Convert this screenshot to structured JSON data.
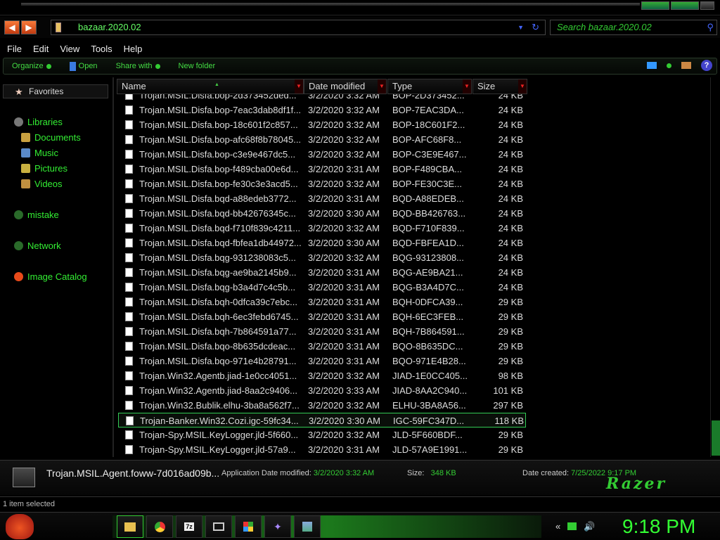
{
  "window": {
    "address": "bazaar.2020.02",
    "search_placeholder": "Search bazaar.2020.02"
  },
  "menu": [
    "File",
    "Edit",
    "View",
    "Tools",
    "Help"
  ],
  "commands": {
    "organize": "Organize",
    "open": "Open",
    "share": "Share with",
    "new_folder": "New folder"
  },
  "nav": {
    "favorites": "Favorites",
    "libraries": "Libraries",
    "documents": "Documents",
    "music": "Music",
    "pictures": "Pictures",
    "videos": "Videos",
    "mistake": "mistake",
    "network": "Network",
    "image_catalog": "Image Catalog"
  },
  "columns": {
    "name": "Name",
    "date": "Date modified",
    "type": "Type",
    "size": "Size"
  },
  "files": [
    [
      "Trojan.MSIL.Disfa.bop-2d373452ded...",
      "3/2/2020 3:32 AM",
      "BOP-2D373452...",
      "24 KB"
    ],
    [
      "Trojan.MSIL.Disfa.bop-7eac3dab8df1f...",
      "3/2/2020 3:32 AM",
      "BOP-7EAC3DA...",
      "24 KB"
    ],
    [
      "Trojan.MSIL.Disfa.bop-18c601f2c857...",
      "3/2/2020 3:32 AM",
      "BOP-18C601F2...",
      "24 KB"
    ],
    [
      "Trojan.MSIL.Disfa.bop-afc68f8b78045...",
      "3/2/2020 3:32 AM",
      "BOP-AFC68F8...",
      "24 KB"
    ],
    [
      "Trojan.MSIL.Disfa.bop-c3e9e467dc5...",
      "3/2/2020 3:32 AM",
      "BOP-C3E9E467...",
      "24 KB"
    ],
    [
      "Trojan.MSIL.Disfa.bop-f489cba00e6d...",
      "3/2/2020 3:31 AM",
      "BOP-F489CBA...",
      "24 KB"
    ],
    [
      "Trojan.MSIL.Disfa.bop-fe30c3e3acd5...",
      "3/2/2020 3:32 AM",
      "BOP-FE30C3E...",
      "24 KB"
    ],
    [
      "Trojan.MSIL.Disfa.bqd-a88edeb3772...",
      "3/2/2020 3:31 AM",
      "BQD-A88EDEB...",
      "24 KB"
    ],
    [
      "Trojan.MSIL.Disfa.bqd-bb42676345c...",
      "3/2/2020 3:30 AM",
      "BQD-BB426763...",
      "24 KB"
    ],
    [
      "Trojan.MSIL.Disfa.bqd-f710f839c4211...",
      "3/2/2020 3:32 AM",
      "BQD-F710F839...",
      "24 KB"
    ],
    [
      "Trojan.MSIL.Disfa.bqd-fbfea1db44972...",
      "3/2/2020 3:30 AM",
      "BQD-FBFEA1D...",
      "24 KB"
    ],
    [
      "Trojan.MSIL.Disfa.bqg-931238083c5...",
      "3/2/2020 3:32 AM",
      "BQG-93123808...",
      "24 KB"
    ],
    [
      "Trojan.MSIL.Disfa.bqg-ae9ba2145b9...",
      "3/2/2020 3:31 AM",
      "BQG-AE9BA21...",
      "24 KB"
    ],
    [
      "Trojan.MSIL.Disfa.bqg-b3a4d7c4c5b...",
      "3/2/2020 3:31 AM",
      "BQG-B3A4D7C...",
      "24 KB"
    ],
    [
      "Trojan.MSIL.Disfa.bqh-0dfca39c7ebc...",
      "3/2/2020 3:31 AM",
      "BQH-0DFCA39...",
      "29 KB"
    ],
    [
      "Trojan.MSIL.Disfa.bqh-6ec3febd6745...",
      "3/2/2020 3:31 AM",
      "BQH-6EC3FEB...",
      "29 KB"
    ],
    [
      "Trojan.MSIL.Disfa.bqh-7b864591a77...",
      "3/2/2020 3:31 AM",
      "BQH-7B864591...",
      "29 KB"
    ],
    [
      "Trojan.MSIL.Disfa.bqo-8b635dcdeac...",
      "3/2/2020 3:31 AM",
      "BQO-8B635DC...",
      "29 KB"
    ],
    [
      "Trojan.MSIL.Disfa.bqo-971e4b28791...",
      "3/2/2020 3:31 AM",
      "BQO-971E4B28...",
      "29 KB"
    ],
    [
      "Trojan.Win32.Agentb.jiad-1e0cc4051...",
      "3/2/2020 3:32 AM",
      "JIAD-1E0CC405...",
      "98 KB"
    ],
    [
      "Trojan.Win32.Agentb.jiad-8aa2c9406...",
      "3/2/2020 3:33 AM",
      "JIAD-8AA2C940...",
      "101 KB"
    ],
    [
      "Trojan.Win32.Bublik.elhu-3ba8a562f7...",
      "3/2/2020 3:32 AM",
      "ELHU-3BA8A56...",
      "297 KB"
    ],
    [
      "Trojan-Banker.Win32.Cozi.igc-59fc34...",
      "3/2/2020 3:30 AM",
      "IGC-59FC347D...",
      "118 KB"
    ],
    [
      "Trojan-Spy.MSIL.KeyLogger.jld-5f660...",
      "3/2/2020 3:32 AM",
      "JLD-5F660BDF...",
      "29 KB"
    ],
    [
      "Trojan-Spy.MSIL.KeyLogger.jld-57a9...",
      "3/2/2020 3:31 AM",
      "JLD-57A9E1991...",
      "29 KB"
    ]
  ],
  "selected_index": 22,
  "details": {
    "name": "Trojan.MSIL.Agent.foww-7d016ad09b...",
    "kind": "Application",
    "date_modified_label": "Date modified:",
    "date_modified": "3/2/2020 3:32 AM",
    "size_label": "Size:",
    "size": "348 KB",
    "date_created_label": "Date created:",
    "date_created": "7/25/2022 9:17 PM",
    "brand": "Razer"
  },
  "status": "1 item selected",
  "clock": "9:18 PM",
  "colors": {
    "accent": "#33cc33",
    "sort_arrow": "#ee2222"
  }
}
